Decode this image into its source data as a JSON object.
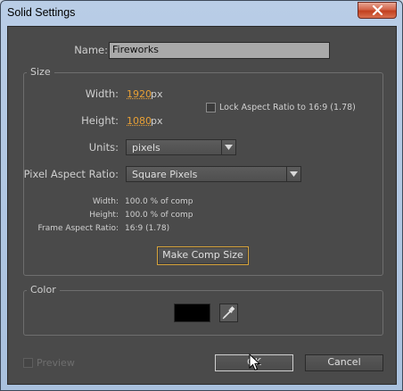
{
  "window": {
    "title": "Solid Settings"
  },
  "name_field": {
    "label": "Name:",
    "value": "Fireworks"
  },
  "size": {
    "group_title": "Size",
    "width_label": "Width:",
    "width_value": "1920",
    "width_unit": "px",
    "height_label": "Height:",
    "height_value": "1080",
    "height_unit": "px",
    "lock_aspect_label": "Lock Aspect Ratio to 16:9 (1.78)",
    "lock_aspect_checked": false,
    "units_label": "Units:",
    "units_value": "pixels",
    "par_label": "Pixel Aspect Ratio:",
    "par_value": "Square Pixels",
    "info": {
      "width_label": "Width:",
      "width_value": "100.0 % of comp",
      "height_label": "Height:",
      "height_value": "100.0 % of comp",
      "far_label": "Frame Aspect Ratio:",
      "far_value": "16:9 (1.78)"
    },
    "make_comp_size_label": "Make Comp Size"
  },
  "color": {
    "group_title": "Color",
    "swatch_hex": "#000000"
  },
  "footer": {
    "preview_label": "Preview",
    "ok_label": "OK",
    "cancel_label": "Cancel"
  },
  "colors": {
    "accent": "#e8a035",
    "panel": "#4a4a4a",
    "highlight_border": "#d7a43c"
  }
}
